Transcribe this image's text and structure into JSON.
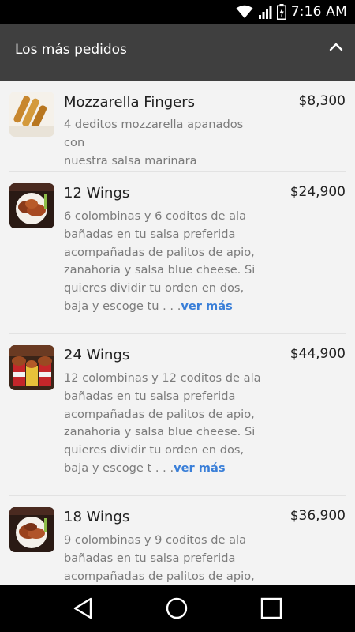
{
  "status_bar": {
    "time": "7:16 AM",
    "icons": [
      "wifi-icon",
      "cell-signal-icon",
      "battery-charging-icon"
    ]
  },
  "section": {
    "title": "Los más pedidos",
    "collapse_icon": "chevron-up-icon"
  },
  "items": [
    {
      "name": "Mozzarella Fingers",
      "price": "$8,300",
      "description": [
        "4 deditos mozzarella apanados con",
        "nuestra salsa marinara"
      ],
      "more_label": ""
    },
    {
      "name": "12 Wings",
      "price": "$24,900",
      "description": [
        "6 colombinas y 6 coditos de ala",
        "bañadas en tu salsa preferida",
        "acompañadas de palitos de apio,",
        "zanahoria y salsa blue cheese. Si",
        "quieres dividir tu orden en dos,",
        "baja y escoge tu . . ."
      ],
      "more_label": "ver más"
    },
    {
      "name": "24 Wings",
      "price": "$44,900",
      "description": [
        "12 colombinas y 12 coditos de ala",
        "bañadas en tu salsa preferida",
        "acompañadas de palitos de apio,",
        "zanahoria y salsa blue cheese. Si",
        "quieres dividir tu orden en dos,",
        "baja y escoge t . . ."
      ],
      "more_label": "ver más"
    },
    {
      "name": "18 Wings",
      "price": "$36,900",
      "description": [
        "9 colombinas y 9 coditos de ala",
        "bañadas en tu salsa preferida",
        "acompañadas de palitos de apio,"
      ],
      "more_label": ""
    }
  ],
  "nav_bar": {
    "icons": [
      "back-icon",
      "home-icon",
      "recents-icon"
    ]
  }
}
